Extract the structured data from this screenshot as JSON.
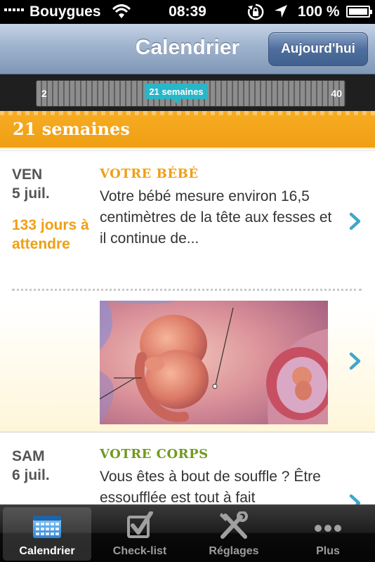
{
  "status_bar": {
    "carrier": "Bouygues",
    "time": "08:39",
    "battery": "100 %",
    "signal_icon": "signal-bars-icon",
    "wifi_icon": "wifi-icon",
    "lock_icon": "rotation-lock-icon",
    "location_icon": "location-arrow-icon",
    "battery_icon": "battery-icon"
  },
  "nav": {
    "title": "Calendrier",
    "today_button": "Aujourd'hui"
  },
  "week_slider": {
    "min": "2",
    "max": "40",
    "current_label": "21 semaines",
    "current_week": 21
  },
  "week_header": {
    "title": "21 semaines"
  },
  "entries": [
    {
      "day": "VEN",
      "date": "5 juil.",
      "countdown": "133 jours à attendre",
      "category": "VOTRE BÉBÉ",
      "category_color": "#ef9f14",
      "text": "Votre bébé mesure environ 16,5 centimètres de la tête aux fesses et il continue de..."
    },
    {
      "day": "SAM",
      "date": "6 juil.",
      "category": "VOTRE CORPS",
      "category_color": "#6f9a1f",
      "text": "Vous êtes à bout de souffle ? Être essoufflée est tout à fait"
    }
  ],
  "colors": {
    "accent_orange": "#ef9f14",
    "accent_teal": "#29b6c9",
    "chevron_blue": "#3ea7c9"
  },
  "tabs": [
    {
      "label": "Calendrier",
      "icon": "calendar-icon",
      "active": true
    },
    {
      "label": "Check-list",
      "icon": "checkbox-icon",
      "active": false
    },
    {
      "label": "Réglages",
      "icon": "tools-icon",
      "active": false
    },
    {
      "label": "Plus",
      "icon": "more-dots-icon",
      "active": false
    }
  ]
}
